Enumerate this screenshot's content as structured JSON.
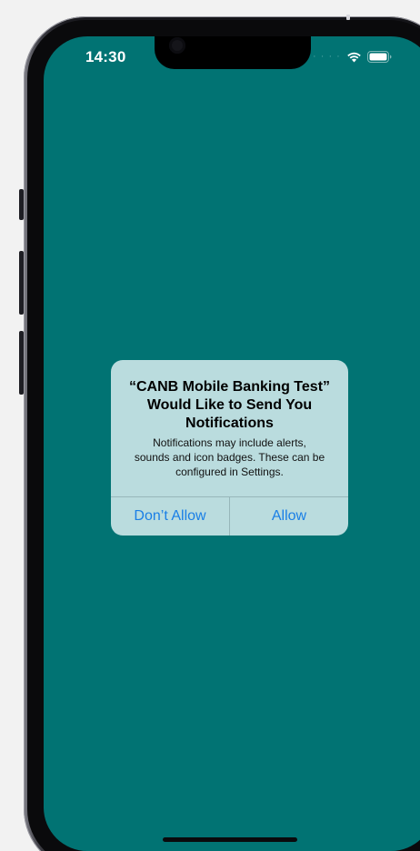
{
  "status_bar": {
    "time": "14:30",
    "signal": "· · · ·",
    "wifi_icon": "wifi-icon",
    "battery_icon": "battery-icon"
  },
  "screen": {
    "background_color": "#017373"
  },
  "alert": {
    "title_line1": "“CANB Mobile Banking Test”",
    "title_line2": "Would Like to Send You",
    "title_line3": "Notifications",
    "message_line1": "Notifications may include alerts,",
    "message_line2": "sounds and icon badges. These can be",
    "message_line3": "configured in Settings.",
    "deny_label": "Don’t Allow",
    "allow_label": "Allow",
    "button_color": "#1a7fe6"
  }
}
